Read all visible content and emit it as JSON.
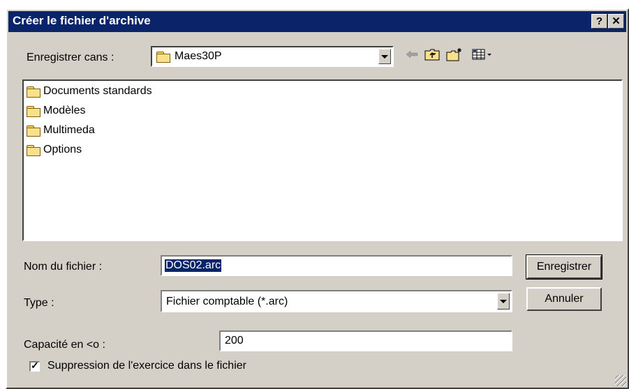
{
  "window": {
    "title": "Créer le fichier d'archive",
    "help_label": "?",
    "close_label": "✕"
  },
  "save_in": {
    "label": "Enregistrer cans :",
    "value": "Maes30P"
  },
  "toolbar": {
    "back_icon": "back-arrow-icon",
    "up_icon": "up-folder-icon",
    "new_folder_icon": "new-folder-icon",
    "view_icon": "view-menu-icon"
  },
  "file_list": [
    {
      "name": "Documents standards"
    },
    {
      "name": "Modèles"
    },
    {
      "name": "Multimeda"
    },
    {
      "name": "Options"
    }
  ],
  "filename": {
    "label": "Nom du fichier :",
    "value": "DOS02.arc"
  },
  "type": {
    "label": "Type :",
    "value": "Fichier comptable (*.arc)"
  },
  "capacity": {
    "label": "Capacité en <o :",
    "value": "200"
  },
  "delete_option": {
    "label": "Suppression de l'exercice dans le fichier",
    "checked": true
  },
  "buttons": {
    "save": "Enregistrer",
    "cancel": "Annuler"
  },
  "colors": {
    "titlebar": "#0a246a",
    "face": "#d4d0c8"
  }
}
